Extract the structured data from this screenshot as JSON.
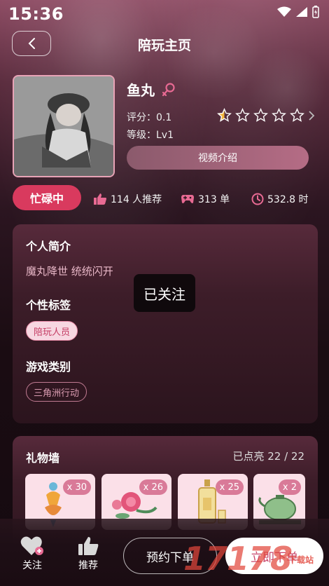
{
  "status_bar": {
    "time": "15:36"
  },
  "header": {
    "title": "陪玩主页"
  },
  "profile": {
    "name": "鱼丸",
    "rating_label": "评分：0.1",
    "level_label": "等级：Lv1",
    "rating_stars": 0.5,
    "video_button": "视频介绍"
  },
  "stats": {
    "status": "忙碌中",
    "recommend": "114 人推荐",
    "orders": "313 单",
    "hours": "532.8 时"
  },
  "intro_card": {
    "intro_title": "个人简介",
    "intro_text": "魔丸降世 统统闪开",
    "tags_title": "个性标签",
    "tag": "陪玩人员",
    "games_title": "游戏类别",
    "game": "三角洲行动"
  },
  "toast": "已关注",
  "gift_wall": {
    "title": "礼物墙",
    "lit_count": "已点亮 22 / 22",
    "gifts": [
      {
        "count": "x 30"
      },
      {
        "count": "x 26"
      },
      {
        "count": "x 25"
      },
      {
        "count": "x 2"
      }
    ]
  },
  "bottom_bar": {
    "follow": "关注",
    "recommend": "推荐",
    "book": "预约下单",
    "order_now": "立即下单"
  },
  "watermark": {
    "main": "17178",
    "sub": "下载站"
  },
  "colors": {
    "accent": "#d93a5e",
    "chip_text": "#c43c63",
    "gift_bg": "#fbe0e8"
  }
}
